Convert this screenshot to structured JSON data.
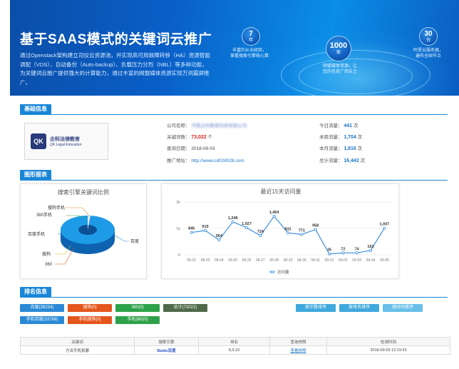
{
  "banner": {
    "title": "基于SAAS模式的关键词云推广",
    "description": "通过Openstack架构建立司仪云资源池，并实现高可用故障转移（HA）资源智能调配（VDS）、自动备份（Auto-backup）、负载压力分烈（NBL）等多种功能，为关键词云推广提供强大的计算能力，通过丰富的网盟媒体资源实现万词霸屏推广。",
    "stats": [
      {
        "num": "7",
        "unit": "年",
        "caption": "丰富的从业经验，\n掌握搜索引擎核心算"
      },
      {
        "num": "1000",
        "unit": "家",
        "caption": "网盟媒体资源，让\n您的信息广而告之"
      },
      {
        "num": "30",
        "unit": "台",
        "caption": "阿里云服务器，\n遍布全国节点"
      }
    ]
  },
  "basic_info": {
    "header": "基础信息",
    "logo": {
      "mark": "QK",
      "line1": "企科法律教育",
      "line2": "QK Legal Education"
    },
    "company_label": "公司名称：",
    "company_value": "河南企科教育科技有限公司",
    "keywords_label": "关键词数：",
    "keywords_value": "73,022",
    "keywords_unit": "个",
    "date_label": "查询日期：",
    "date_value": "2018-09-03",
    "url_label": "推广地址：",
    "url_value": "http://www.cd028028.com",
    "today_label": "今日流量：",
    "today_value": "441",
    "week_label": "本周流量：",
    "week_value": "1,704",
    "month_label": "本月流量：",
    "month_value": "1,816",
    "total_label": "总计流量：",
    "total_value": "16,442",
    "unit_times": "次"
  },
  "charts_section": {
    "header": "图形报表"
  },
  "pie": {
    "title": "搜索引擎关键词比例",
    "labels": [
      "搜狗手机",
      "360手机",
      "百度手机",
      "搜狗",
      "360",
      "百度"
    ]
  },
  "chart_data": {
    "type": "line",
    "title": "最近15天访问量",
    "categories": [
      "08-22",
      "08-23",
      "08-24",
      "08-25",
      "08-26",
      "08-27",
      "08-28",
      "08-29",
      "08-30",
      "08-31",
      "09-01",
      "09-02",
      "09-03",
      "09-04",
      "09-05"
    ],
    "series": [
      {
        "name": "访问量",
        "values": [
          845,
          919,
          564,
          1248,
          1027,
          724,
          1464,
          831,
          771,
          958,
          35,
          72,
          74,
          163,
          1007
        ]
      }
    ],
    "data_labels": [
      "845",
      "919",
      "564",
      "1,248",
      "1,027",
      "724",
      "1,464",
      "831",
      "771",
      "958",
      "35",
      "72",
      "74",
      "163",
      "1,007"
    ],
    "y_ticks": [
      "0",
      "1k",
      "2k"
    ],
    "ylim": [
      0,
      2000
    ],
    "grid": true,
    "legend_position": "bottom",
    "colors": {
      "line": "#3d8fe0",
      "point": "#ffffff",
      "grid": "#e6e6e6"
    }
  },
  "ranking": {
    "header": "排名信息",
    "row1": [
      "百度(39234)",
      "搜狗(0)",
      "360(0)",
      "总计(73022)"
    ],
    "row2": [
      "手机百度(33788)",
      "手机搜狗(0)",
      "手机360(0)"
    ],
    "sort_buttons": [
      "按字数排序",
      "按排名排序",
      "按时间排序"
    ],
    "table": {
      "headers": [
        "关键词",
        "搜索引擎",
        "排名",
        "查询快照",
        "检测时间"
      ],
      "rows": [
        [
          "方法手机拓展",
          "Baidu百度",
          "8,9,10",
          "查看快照",
          "2018-09-03 13:19:33"
        ]
      ]
    }
  }
}
